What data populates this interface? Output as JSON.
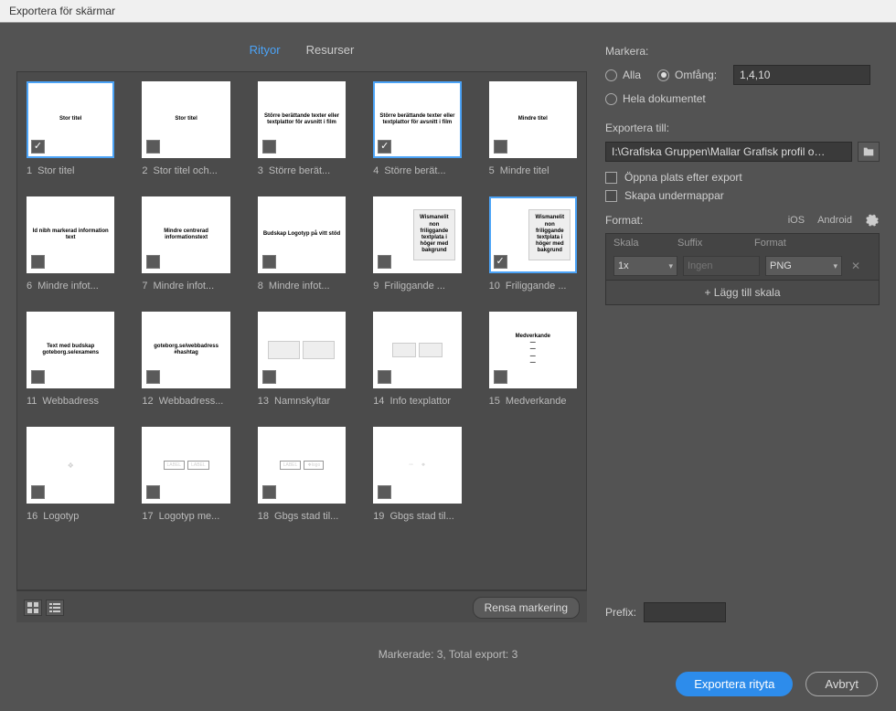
{
  "window_title": "Exportera för skärmar",
  "tabs": {
    "artboards": "Rityor",
    "resources": "Resurser"
  },
  "thumbs": [
    {
      "num": "1",
      "name": "Stor titel",
      "selected": true,
      "checked": true,
      "preview": "Stor titel"
    },
    {
      "num": "2",
      "name": "Stor titel och...",
      "selected": false,
      "checked": false,
      "preview": "Stor titel"
    },
    {
      "num": "3",
      "name": "Större berät...",
      "selected": false,
      "checked": false,
      "preview": "Större berättande texter eller textplattor för avsnitt i film"
    },
    {
      "num": "4",
      "name": "Större berät...",
      "selected": true,
      "checked": true,
      "preview": "Större berättande texter eller textplattor för avsnitt i film"
    },
    {
      "num": "5",
      "name": "Mindre titel",
      "selected": false,
      "checked": false,
      "preview": "Mindre titel"
    },
    {
      "num": "6",
      "name": "Mindre infot...",
      "selected": false,
      "checked": false,
      "preview": "Id nibh markerad information text"
    },
    {
      "num": "7",
      "name": "Mindre infot...",
      "selected": false,
      "checked": false,
      "preview": "Mindre centrerad informationstext"
    },
    {
      "num": "8",
      "name": "Mindre infot...",
      "selected": false,
      "checked": false,
      "preview": "Budskap Logotyp på vitt stöd"
    },
    {
      "num": "9",
      "name": "Friliggande ...",
      "selected": false,
      "checked": false,
      "preview": "half"
    },
    {
      "num": "10",
      "name": "Friliggande ...",
      "selected": true,
      "checked": true,
      "preview": "half2"
    },
    {
      "num": "11",
      "name": "Webbadress",
      "selected": false,
      "checked": false,
      "preview": "Text med budskap goteborg.se/examens"
    },
    {
      "num": "12",
      "name": "Webbadress...",
      "selected": false,
      "checked": false,
      "preview": "goteborg.se/webbadress #hashtag"
    },
    {
      "num": "13",
      "name": "Namnskyltar",
      "selected": false,
      "checked": false,
      "preview": "two"
    },
    {
      "num": "14",
      "name": "Info texplattor",
      "selected": false,
      "checked": false,
      "preview": "two-small"
    },
    {
      "num": "15",
      "name": "Medverkande",
      "selected": false,
      "checked": false,
      "preview": "Medverkande\n—\n—\n—\n—"
    },
    {
      "num": "16",
      "name": "Logotyp",
      "selected": false,
      "checked": false,
      "preview": "logo"
    },
    {
      "num": "17",
      "name": "Logotyp me...",
      "selected": false,
      "checked": false,
      "preview": "tags"
    },
    {
      "num": "18",
      "name": "Gbgs stad til...",
      "selected": false,
      "checked": false,
      "preview": "logo-pair"
    },
    {
      "num": "19",
      "name": "Gbgs stad til...",
      "selected": false,
      "checked": false,
      "preview": "logo-pair2"
    }
  ],
  "right": {
    "select_label": "Markera:",
    "radio_all": "Alla",
    "radio_range": "Omfång:",
    "range_value": "1,4,10",
    "radio_full_doc": "Hela dokumentet",
    "export_to_label": "Exportera till:",
    "path_value": "I:\\Grafiska Gruppen\\Mallar Grafisk profil o…",
    "open_after": "Öppna plats efter export",
    "create_subfolders": "Skapa undermappar",
    "format_label": "Format:",
    "ios": "iOS",
    "android": "Android",
    "col_scale": "Skala",
    "col_suffix": "Suffix",
    "col_format": "Format",
    "scale_value": "1x",
    "suffix_placeholder": "Ingen",
    "format_value": "PNG",
    "add_scale": "+  Lägg till skala",
    "prefix_label": "Prefix:",
    "prefix_value": ""
  },
  "bottom": {
    "clear_selection": "Rensa markering",
    "status": "Markerade: 3, Total export: 3",
    "export_btn": "Exportera rityta",
    "cancel_btn": "Avbryt"
  }
}
